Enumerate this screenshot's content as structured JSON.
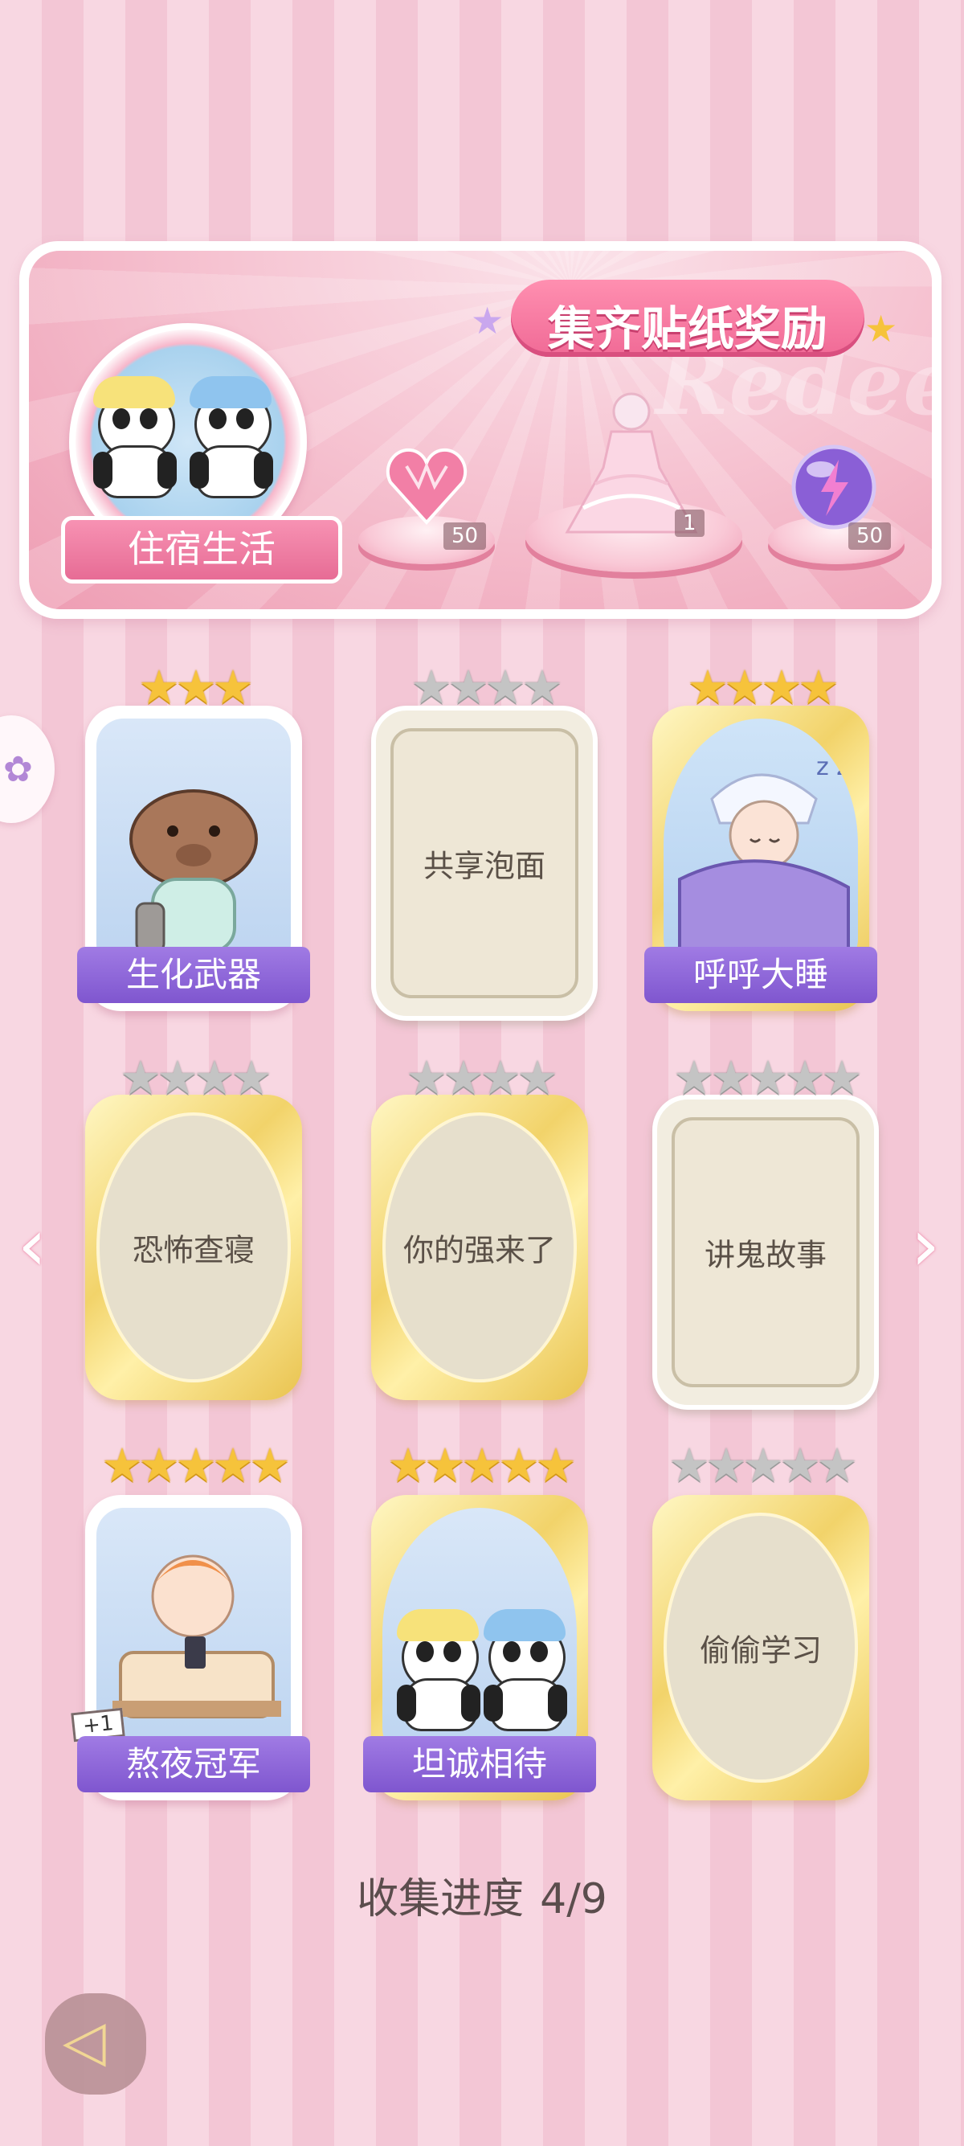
{
  "banner": {
    "title": "集齐贴纸奖励",
    "watermark": "Redeem",
    "theme_label": "住宿生活",
    "rewards": [
      {
        "icon": "heart-gem-icon",
        "count": "50"
      },
      {
        "icon": "dress-outfit-icon",
        "count": "1"
      },
      {
        "icon": "energy-orb-icon",
        "count": "50"
      }
    ]
  },
  "cards": [
    {
      "name": "生化武器",
      "stars_total": 3,
      "stars_filled": 3,
      "collected": true,
      "frame": "white",
      "art": "capybara-pajama-icon"
    },
    {
      "name": "共享泡面",
      "stars_total": 4,
      "stars_filled": 0,
      "collected": false,
      "frame": "plain"
    },
    {
      "name": "呼呼大睡",
      "stars_total": 4,
      "stars_filled": 4,
      "collected": true,
      "frame": "gold",
      "art": "sleeping-boy-icon"
    },
    {
      "name": "恐怖查寝",
      "stars_total": 4,
      "stars_filled": 0,
      "collected": false,
      "frame": "gold"
    },
    {
      "name": "你的强来了",
      "stars_total": 4,
      "stars_filled": 0,
      "collected": false,
      "frame": "gold"
    },
    {
      "name": "讲鬼故事",
      "stars_total": 5,
      "stars_filled": 0,
      "collected": false,
      "frame": "plain"
    },
    {
      "name": "熬夜冠军",
      "stars_total": 5,
      "stars_filled": 5,
      "collected": true,
      "frame": "white",
      "art": "boy-phone-bed-icon",
      "badge": "+1"
    },
    {
      "name": "坦诚相待",
      "stars_total": 5,
      "stars_filled": 5,
      "collected": true,
      "frame": "gold",
      "art": "pandas-bath-icon"
    },
    {
      "name": "偷偷学习",
      "stars_total": 5,
      "stars_filled": 0,
      "collected": false,
      "frame": "gold"
    }
  ],
  "progress": {
    "label": "收集进度",
    "value": "4/9"
  },
  "colors": {
    "accent_pink": "#f06a96",
    "label_purple": "#7f56cf",
    "star_gold": "#f6c33b",
    "star_grey": "#c4c4c4"
  }
}
